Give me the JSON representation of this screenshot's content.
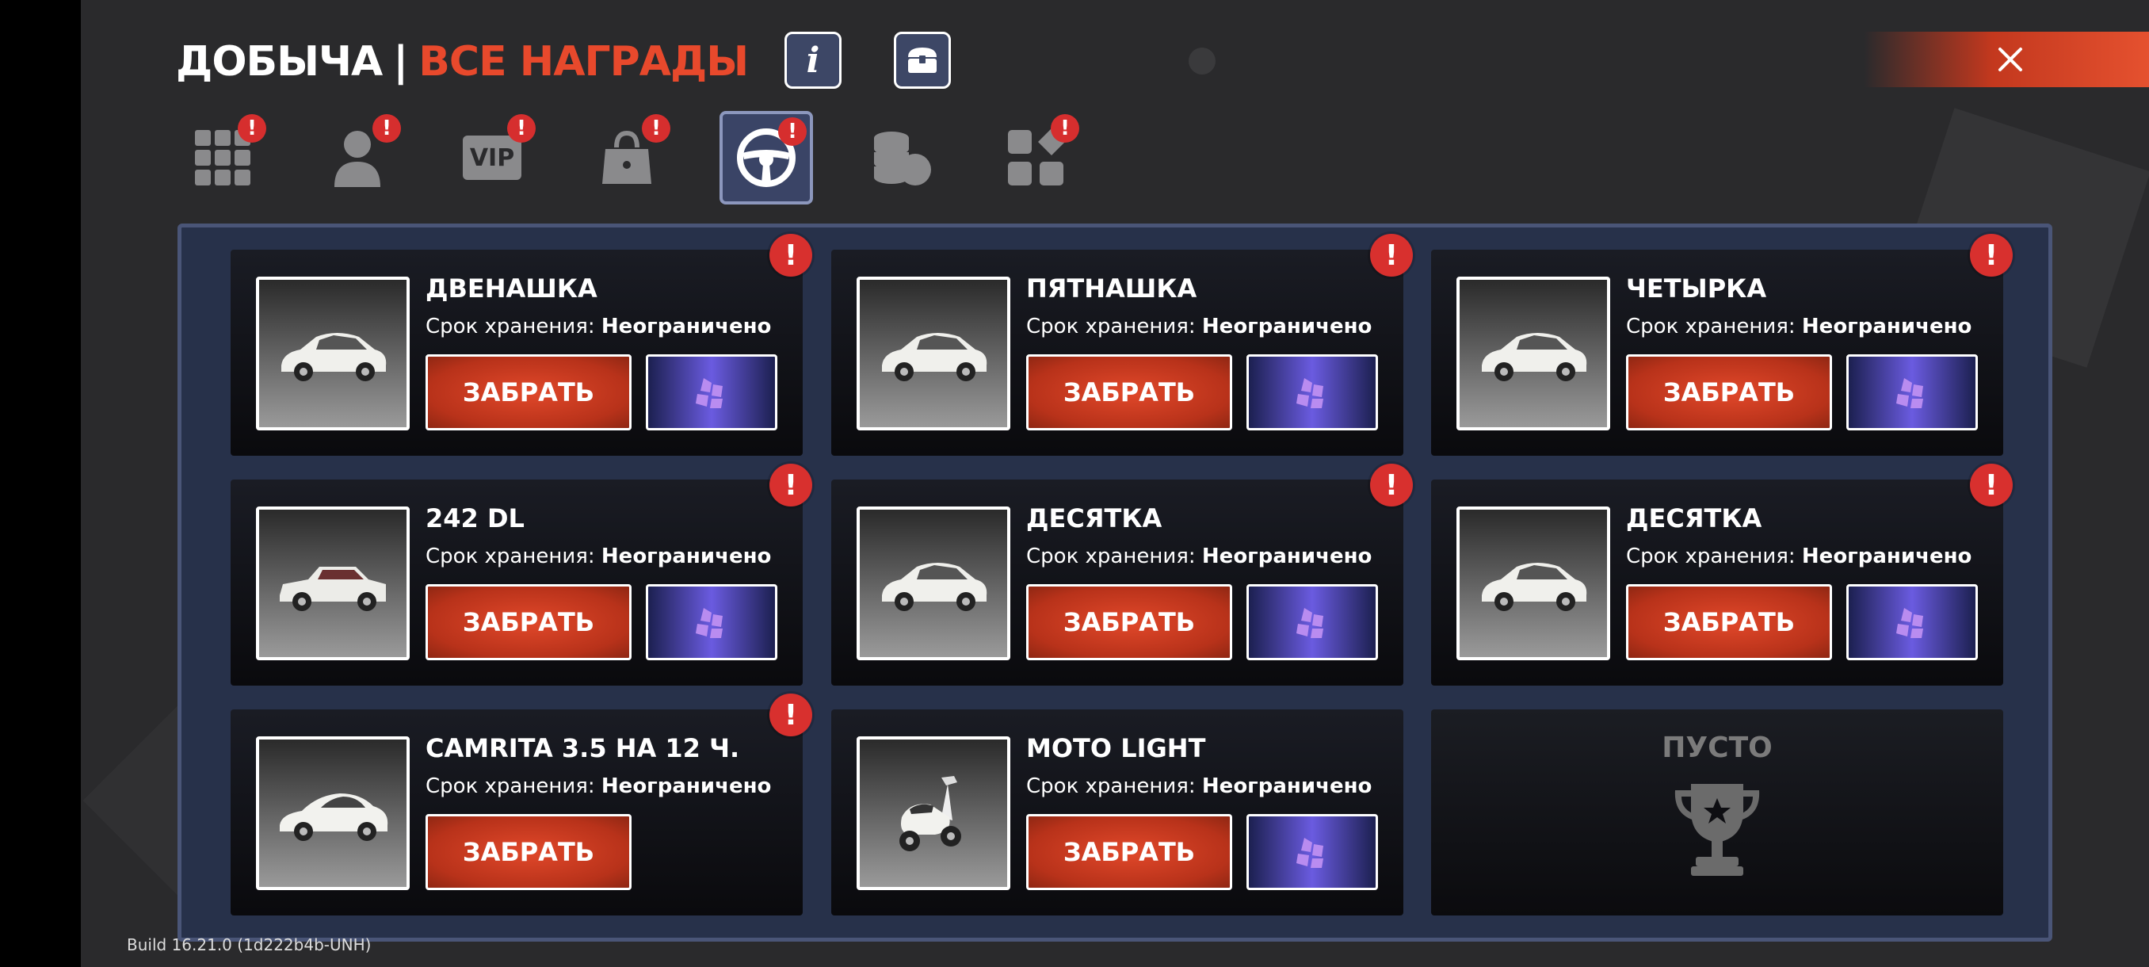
{
  "header": {
    "title_main": "ДОБЫЧА",
    "title_sep": "|",
    "title_accent": "ВСЕ НАГРАДЫ",
    "info_label": "i"
  },
  "colors": {
    "accent": "#e8492c",
    "alert": "#d8302e",
    "panel": "#27314a",
    "gem": "#6a5be0"
  },
  "tabs": [
    {
      "icon": "grid-icon",
      "badge": "!"
    },
    {
      "icon": "user-icon",
      "badge": "!"
    },
    {
      "icon": "vip-icon",
      "label": "VIP",
      "badge": "!"
    },
    {
      "icon": "bag-icon",
      "badge": "!"
    },
    {
      "icon": "steering-wheel-icon",
      "badge": "!",
      "active": true
    },
    {
      "icon": "coins-icon"
    },
    {
      "icon": "apps-icon",
      "badge": "!"
    }
  ],
  "rewards": [
    {
      "name": "ДВЕНАШКА",
      "storage_label": "Срок хранения:",
      "storage_value": "Неограничено",
      "claim": "ЗАБРАТЬ",
      "alert": "!"
    },
    {
      "name": "ПЯТНАШКА",
      "storage_label": "Срок хранения:",
      "storage_value": "Неограничено",
      "claim": "ЗАБРАТЬ",
      "alert": "!"
    },
    {
      "name": "ЧЕТЫРКА",
      "storage_label": "Срок хранения:",
      "storage_value": "Неограничено",
      "claim": "ЗАБРАТЬ",
      "alert": "!"
    },
    {
      "name": "242 DL",
      "storage_label": "Срок хранения:",
      "storage_value": "Неограничено",
      "claim": "ЗАБРАТЬ",
      "alert": "!"
    },
    {
      "name": "ДЕСЯТКА",
      "storage_label": "Срок хранения:",
      "storage_value": "Неограничено",
      "claim": "ЗАБРАТЬ",
      "alert": "!"
    },
    {
      "name": "ДЕСЯТКА",
      "storage_label": "Срок хранения:",
      "storage_value": "Неограничено",
      "claim": "ЗАБРАТЬ",
      "alert": "!"
    },
    {
      "name": "CAMRITA 3.5 НА 12 Ч.",
      "storage_label": "Срок хранения:",
      "storage_value": "Неограничено",
      "claim": "ЗАБРАТЬ",
      "alert": "!"
    },
    {
      "name": "MOTO LIGHT",
      "storage_label": "Срок хранения:",
      "storage_value": "Неограничено",
      "claim": "ЗАБРАТЬ"
    }
  ],
  "empty_slot": {
    "label": "ПУСТО"
  },
  "build": "Build 16.21.0 (1d222b4b-UNH)"
}
